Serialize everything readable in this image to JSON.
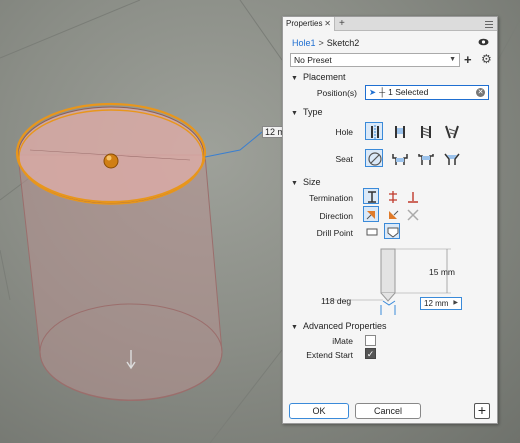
{
  "viewport": {
    "dimension_label": "12 m"
  },
  "panel": {
    "tab_label": "Properties",
    "breadcrumb": {
      "item1": "Hole1",
      "separator": ">",
      "item2": "Sketch2"
    },
    "preset": {
      "value": "No Preset"
    },
    "placement": {
      "header": "Placement",
      "position_label": "Position(s)",
      "position_value": "1 Selected"
    },
    "type": {
      "header": "Type",
      "hole_label": "Hole",
      "hole_options": [
        "simple-hole-icon",
        "clearance-hole-icon",
        "tapped-hole-icon",
        "taper-tapped-hole-icon"
      ],
      "hole_selected": 0,
      "seat_label": "Seat",
      "seat_options": [
        "no-seat-icon",
        "counterbore-icon",
        "spotface-icon",
        "countersink-icon"
      ],
      "seat_selected": 0
    },
    "size": {
      "header": "Size",
      "termination_label": "Termination",
      "termination_options": [
        "distance-icon",
        "through-all-icon",
        "to-icon"
      ],
      "termination_selected": 0,
      "direction_label": "Direction",
      "direction_options": [
        "default-direction-icon",
        "flipped-direction-icon",
        "symmetric-direction-icon"
      ],
      "direction_selected": 0,
      "drill_point_label": "Drill Point",
      "drill_point_options": [
        "flat-drill-point-icon",
        "angle-drill-point-icon"
      ],
      "drill_point_selected": 1,
      "depth": "15 mm",
      "angle": "118 deg",
      "diameter": "12 mm"
    },
    "advanced": {
      "header": "Advanced Properties",
      "imate_label": "iMate",
      "imate_checked": false,
      "extend_start_label": "Extend Start",
      "extend_start_checked": true
    },
    "buttons": {
      "ok": "OK",
      "cancel": "Cancel"
    }
  },
  "colors": {
    "accent": "#1f6fd1",
    "selection_orange": "#e8961c",
    "cylinder_fill": "#c89a98"
  }
}
